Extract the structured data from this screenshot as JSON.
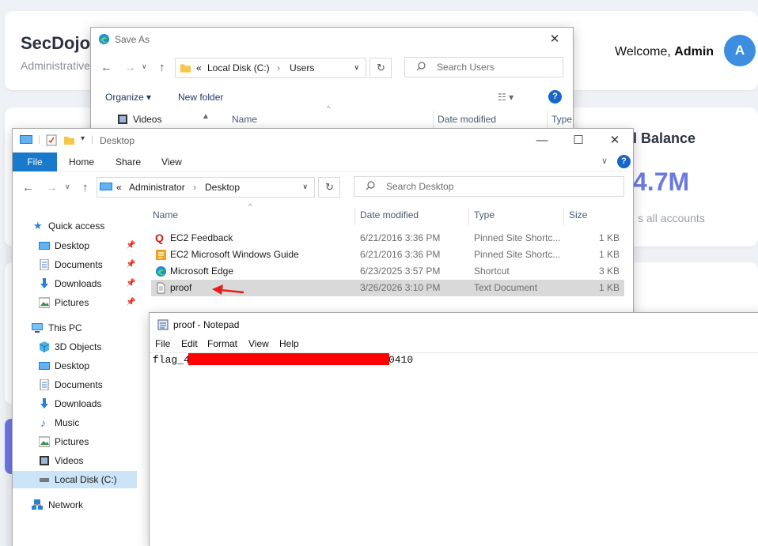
{
  "app": {
    "brand": "SecDojo",
    "brand_sub": "Administrative",
    "welcome_prefix": "Welcome, ",
    "welcome_user": "Admin",
    "avatar_letter": "A",
    "balance_title": "l Balance",
    "balance_value": "4.7M",
    "balance_note": "s all accounts",
    "accent_color": "#6b7ae0"
  },
  "save_as": {
    "title": "Save As",
    "breadcrumb": [
      "«",
      "Local Disk (C:)",
      "›",
      "Users"
    ],
    "search_placeholder": "Search Users",
    "toolbar": {
      "organize": "Organize ▾",
      "new_folder": "New folder",
      "help": "?"
    },
    "nav_item": "Videos",
    "columns": {
      "name": "Name",
      "date": "Date modified",
      "type": "Type"
    }
  },
  "explorer": {
    "title": "Desktop",
    "ribbon_tabs": [
      "File",
      "Home",
      "Share",
      "View"
    ],
    "breadcrumb": [
      "«",
      "Administrator",
      "›",
      "Desktop"
    ],
    "search_placeholder": "Search Desktop",
    "help": "?",
    "nav": {
      "quick_access": "Quick access",
      "qa_items": [
        "Desktop",
        "Documents",
        "Downloads",
        "Pictures"
      ],
      "this_pc": "This PC",
      "pc_items": [
        "3D Objects",
        "Desktop",
        "Documents",
        "Downloads",
        "Music",
        "Pictures",
        "Videos",
        "Local Disk (C:)"
      ],
      "network": "Network"
    },
    "columns": {
      "name": "Name",
      "date": "Date modified",
      "type": "Type",
      "size": "Size"
    },
    "files": [
      {
        "name": "EC2 Feedback",
        "date": "6/21/2016 3:36 PM",
        "type": "Pinned Site Shortc...",
        "size": "1 KB",
        "icon": "quiz-icon"
      },
      {
        "name": "EC2 Microsoft Windows Guide",
        "date": "6/21/2016 3:36 PM",
        "type": "Pinned Site Shortc...",
        "size": "1 KB",
        "icon": "guide-icon"
      },
      {
        "name": "Microsoft Edge",
        "date": "6/23/2025 3:57 PM",
        "type": "Shortcut",
        "size": "3 KB",
        "icon": "edge-icon"
      },
      {
        "name": "proof",
        "date": "3/26/2026 3:10 PM",
        "type": "Text Document",
        "size": "1 KB",
        "icon": "text-file-icon"
      }
    ]
  },
  "notepad": {
    "title": "proof - Notepad",
    "menu": [
      "File",
      "Edit",
      "Format",
      "View",
      "Help"
    ],
    "text_start": "flag_4",
    "text_end": "0410",
    "redaction_color": "#ff0000"
  }
}
